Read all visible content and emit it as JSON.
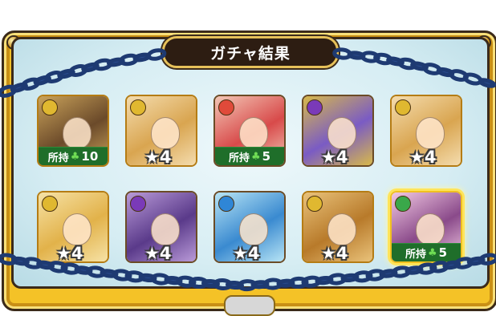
{
  "header": {
    "title": "ガチャ結果"
  },
  "results": [
    {
      "kind": "owned",
      "owned_label": "所持",
      "owned_count": "10",
      "element": "light",
      "element_icon": "light-element-icon",
      "colors": [
        "#6b4a2a",
        "#c9a25a"
      ]
    },
    {
      "kind": "star",
      "star_label": "★4",
      "element": "light",
      "element_icon": "light-element-icon",
      "colors": [
        "#d9a550",
        "#f4dcae"
      ]
    },
    {
      "kind": "owned",
      "owned_label": "所持",
      "owned_count": "5",
      "element": "fire",
      "element_icon": "fire-element-icon",
      "colors": [
        "#d84a4a",
        "#f3c7b6"
      ]
    },
    {
      "kind": "star",
      "star_label": "★4",
      "element": "dark",
      "element_icon": "dark-element-icon",
      "colors": [
        "#7a5bc4",
        "#d8b94a"
      ]
    },
    {
      "kind": "star",
      "star_label": "★4",
      "element": "light",
      "element_icon": "light-element-icon",
      "colors": [
        "#d9a550",
        "#f4dcae"
      ]
    },
    {
      "kind": "star",
      "star_label": "★4",
      "element": "light",
      "element_icon": "light-element-icon",
      "colors": [
        "#e2b24a",
        "#f6e2a6"
      ]
    },
    {
      "kind": "star",
      "star_label": "★4",
      "element": "dark",
      "element_icon": "dark-element-icon",
      "colors": [
        "#5a3a8a",
        "#b99ad8"
      ]
    },
    {
      "kind": "star",
      "star_label": "★4",
      "element": "water",
      "element_icon": "water-element-icon",
      "colors": [
        "#3a8ad0",
        "#b7e4f5"
      ]
    },
    {
      "kind": "star",
      "star_label": "★4",
      "element": "light",
      "element_icon": "light-element-icon",
      "colors": [
        "#b87a2a",
        "#e9c27a"
      ]
    },
    {
      "kind": "owned",
      "owned_label": "所持",
      "owned_count": "5",
      "element": "wood",
      "element_icon": "wood-element-icon",
      "colors": [
        "#8a4a8a",
        "#f2c9e3"
      ],
      "selected": true
    }
  ],
  "element_colors": {
    "light": "#e0b830",
    "fire": "#e04a3a",
    "dark": "#7a3ab8",
    "water": "#2f86d6",
    "wood": "#3aa84a"
  },
  "frame_colors": {
    "gold": "#f4c227",
    "inner": "#d6edf3",
    "outline": "#3b2a1a",
    "chain": "#1e3a72"
  }
}
